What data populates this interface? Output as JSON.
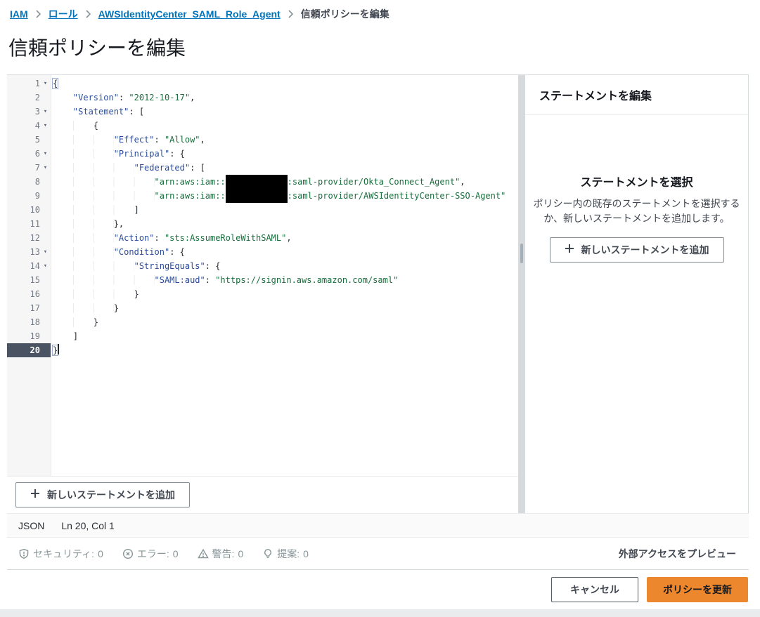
{
  "breadcrumb": {
    "items": [
      {
        "label": "IAM"
      },
      {
        "label": "ロール"
      },
      {
        "label": "AWSIdentityCenter_SAML_Role_Agent"
      }
    ],
    "current": "信頼ポリシーを編集"
  },
  "page": {
    "title": "信頼ポリシーを編集"
  },
  "editor": {
    "language": "JSON",
    "cursor_position": "Ln 20, Col 1",
    "active_line": 20,
    "add_statement_label": "新しいステートメントを追加",
    "lines": [
      {
        "n": 1,
        "fold": true,
        "ind": 0,
        "t": [
          [
            "b",
            "{"
          ]
        ]
      },
      {
        "n": 2,
        "ind": 4,
        "t": [
          [
            "k",
            "\"Version\""
          ],
          [
            "p",
            ": "
          ],
          [
            "s",
            "\"2012-10-17\""
          ],
          [
            "p",
            ","
          ]
        ]
      },
      {
        "n": 3,
        "fold": true,
        "ind": 4,
        "t": [
          [
            "k",
            "\"Statement\""
          ],
          [
            "p",
            ": ["
          ]
        ]
      },
      {
        "n": 4,
        "fold": true,
        "ind": 8,
        "t": [
          [
            "p",
            "{"
          ]
        ]
      },
      {
        "n": 5,
        "ind": 12,
        "t": [
          [
            "k",
            "\"Effect\""
          ],
          [
            "p",
            ": "
          ],
          [
            "s",
            "\"Allow\""
          ],
          [
            "p",
            ","
          ]
        ]
      },
      {
        "n": 6,
        "fold": true,
        "ind": 12,
        "t": [
          [
            "k",
            "\"Principal\""
          ],
          [
            "p",
            ": {"
          ]
        ]
      },
      {
        "n": 7,
        "fold": true,
        "ind": 16,
        "t": [
          [
            "k",
            "\"Federated\""
          ],
          [
            "p",
            ": ["
          ]
        ]
      },
      {
        "n": 8,
        "ind": 20,
        "t": [
          [
            "s",
            "\"arn:aws:iam::"
          ],
          [
            "r",
            ""
          ],
          [
            "s",
            ":saml-provider/Okta_Connect_Agent\""
          ],
          [
            "p",
            ","
          ]
        ]
      },
      {
        "n": 9,
        "ind": 20,
        "t": [
          [
            "s",
            "\"arn:aws:iam::"
          ],
          [
            "r",
            ""
          ],
          [
            "s",
            ":saml-provider/AWSIdentityCenter-SSO-Agent\""
          ]
        ]
      },
      {
        "n": 10,
        "ind": 16,
        "t": [
          [
            "p",
            "]"
          ]
        ]
      },
      {
        "n": 11,
        "ind": 12,
        "t": [
          [
            "p",
            "},"
          ]
        ]
      },
      {
        "n": 12,
        "ind": 12,
        "t": [
          [
            "k",
            "\"Action\""
          ],
          [
            "p",
            ": "
          ],
          [
            "s",
            "\"sts:AssumeRoleWithSAML\""
          ],
          [
            "p",
            ","
          ]
        ]
      },
      {
        "n": 13,
        "fold": true,
        "ind": 12,
        "t": [
          [
            "k",
            "\"Condition\""
          ],
          [
            "p",
            ": {"
          ]
        ]
      },
      {
        "n": 14,
        "fold": true,
        "ind": 16,
        "t": [
          [
            "k",
            "\"StringEquals\""
          ],
          [
            "p",
            ": {"
          ]
        ]
      },
      {
        "n": 15,
        "ind": 20,
        "t": [
          [
            "k",
            "\"SAML:aud\""
          ],
          [
            "p",
            ": "
          ],
          [
            "s",
            "\"https://signin.aws.amazon.com/saml\""
          ]
        ]
      },
      {
        "n": 16,
        "ind": 16,
        "t": [
          [
            "p",
            "}"
          ]
        ]
      },
      {
        "n": 17,
        "ind": 12,
        "t": [
          [
            "p",
            "}"
          ]
        ]
      },
      {
        "n": 18,
        "ind": 8,
        "t": [
          [
            "p",
            "}"
          ]
        ]
      },
      {
        "n": 19,
        "ind": 4,
        "t": [
          [
            "p",
            "]"
          ]
        ]
      },
      {
        "n": 20,
        "active": true,
        "ind": 0,
        "t": [
          [
            "b",
            "}"
          ]
        ]
      }
    ]
  },
  "panel": {
    "header": "ステートメントを編集",
    "empty_title": "ステートメントを選択",
    "empty_desc": "ポリシー内の既存のステートメントを選択するか、新しいステートメントを追加します。",
    "add_button": "新しいステートメントを追加"
  },
  "validation": {
    "items": [
      {
        "icon": "shield-alert-icon",
        "label": "セキュリティ:",
        "count": "0"
      },
      {
        "icon": "error-circle-icon",
        "label": "エラー:",
        "count": "0"
      },
      {
        "icon": "warning-triangle-icon",
        "label": "警告:",
        "count": "0"
      },
      {
        "icon": "suggestion-bulb-icon",
        "label": "提案:",
        "count": "0"
      }
    ],
    "preview_external_access": "外部アクセスをプレビュー"
  },
  "actions": {
    "cancel": "キャンセル",
    "update": "ポリシーを更新"
  },
  "colors": {
    "accent_orange": "#ec872d",
    "link_blue": "#0073bb",
    "key_blue": "#2a4b9b",
    "string_green": "#166e3b"
  }
}
